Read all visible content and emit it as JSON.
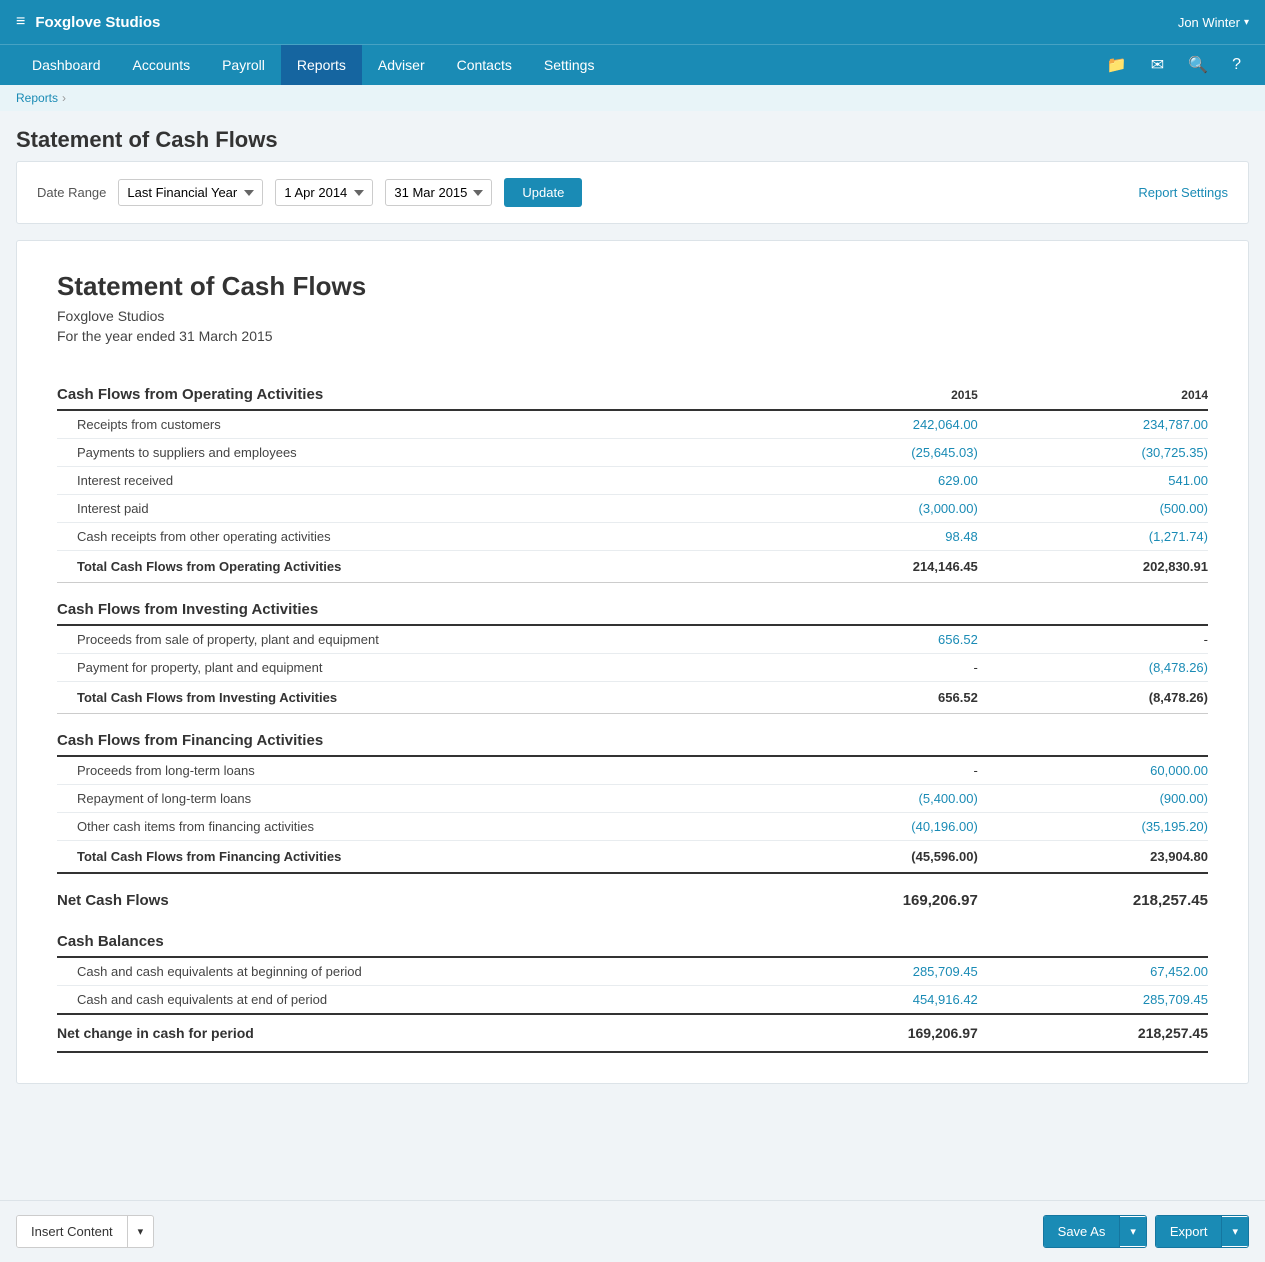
{
  "app": {
    "logo": "≡",
    "title": "Foxglove Studios",
    "user": "Jon Winter",
    "user_arrow": "▾"
  },
  "nav": {
    "items": [
      {
        "label": "Dashboard",
        "active": false
      },
      {
        "label": "Accounts",
        "active": false
      },
      {
        "label": "Payroll",
        "active": false
      },
      {
        "label": "Reports",
        "active": true
      },
      {
        "label": "Adviser",
        "active": false
      },
      {
        "label": "Contacts",
        "active": false
      },
      {
        "label": "Settings",
        "active": false
      }
    ],
    "icons": [
      "📁",
      "✉",
      "🔍",
      "?"
    ]
  },
  "breadcrumb": {
    "parent": "Reports",
    "separator": "›"
  },
  "page": {
    "title": "Statement of Cash Flows"
  },
  "filters": {
    "date_range_label": "Date Range",
    "date_range_value": "Last Financial Year",
    "date_from": "1 Apr 2014",
    "date_to": "31 Mar 2015",
    "update_btn": "Update",
    "report_settings": "Report Settings"
  },
  "report": {
    "title": "Statement of Cash Flows",
    "company": "Foxglove Studios",
    "period": "For the year ended 31 March 2015",
    "year1": "2015",
    "year2": "2014",
    "sections": [
      {
        "heading": "Cash Flows from Operating Activities",
        "rows": [
          {
            "label": "Receipts from customers",
            "v1": "242,064.00",
            "v2": "234,787.00",
            "v1_blue": true,
            "v2_blue": true
          },
          {
            "label": "Payments to suppliers and employees",
            "v1": "(25,645.03)",
            "v2": "(30,725.35)",
            "v1_blue": true,
            "v2_blue": true
          },
          {
            "label": "Interest received",
            "v1": "629.00",
            "v2": "541.00",
            "v1_blue": true,
            "v2_blue": true
          },
          {
            "label": "Interest paid",
            "v1": "(3,000.00)",
            "v2": "(500.00)",
            "v1_blue": true,
            "v2_blue": true
          },
          {
            "label": "Cash receipts from other operating activities",
            "v1": "98.48",
            "v2": "(1,271.74)",
            "v1_blue": true,
            "v2_blue": true
          }
        ],
        "total_label": "Total Cash Flows from Operating Activities",
        "total_v1": "214,146.45",
        "total_v2": "202,830.91"
      },
      {
        "heading": "Cash Flows from Investing Activities",
        "rows": [
          {
            "label": "Proceeds from sale of property, plant and equipment",
            "v1": "656.52",
            "v2": "-",
            "v1_blue": true,
            "v2_blue": false
          },
          {
            "label": "Payment for property, plant and equipment",
            "v1": "-",
            "v2": "(8,478.26)",
            "v1_blue": false,
            "v2_blue": true
          }
        ],
        "total_label": "Total Cash Flows from Investing Activities",
        "total_v1": "656.52",
        "total_v2": "(8,478.26)"
      },
      {
        "heading": "Cash Flows from Financing Activities",
        "rows": [
          {
            "label": "Proceeds from long-term loans",
            "v1": "-",
            "v2": "60,000.00",
            "v1_blue": false,
            "v2_blue": true
          },
          {
            "label": "Repayment of long-term loans",
            "v1": "(5,400.00)",
            "v2": "(900.00)",
            "v1_blue": true,
            "v2_blue": true
          },
          {
            "label": "Other cash items from financing activities",
            "v1": "(40,196.00)",
            "v2": "(35,195.20)",
            "v1_blue": true,
            "v2_blue": true
          }
        ],
        "total_label": "Total Cash Flows from Financing Activities",
        "total_v1": "(45,596.00)",
        "total_v2": "23,904.80"
      }
    ],
    "net_cash": {
      "label": "Net Cash Flows",
      "v1": "169,206.97",
      "v2": "218,257.45"
    },
    "balances": {
      "heading": "Cash Balances",
      "rows": [
        {
          "label": "Cash and cash equivalents at beginning of period",
          "v1": "285,709.45",
          "v2": "67,452.00",
          "v1_blue": true,
          "v2_blue": true
        },
        {
          "label": "Cash and cash equivalents at end of period",
          "v1": "454,916.42",
          "v2": "285,709.45",
          "v1_blue": true,
          "v2_blue": true
        }
      ],
      "total_label": "Net change in cash for period",
      "total_v1": "169,206.97",
      "total_v2": "218,257.45"
    }
  },
  "footer": {
    "insert_content": "Insert Content",
    "save_as": "Save As",
    "export": "Export",
    "arrow": "▾"
  }
}
